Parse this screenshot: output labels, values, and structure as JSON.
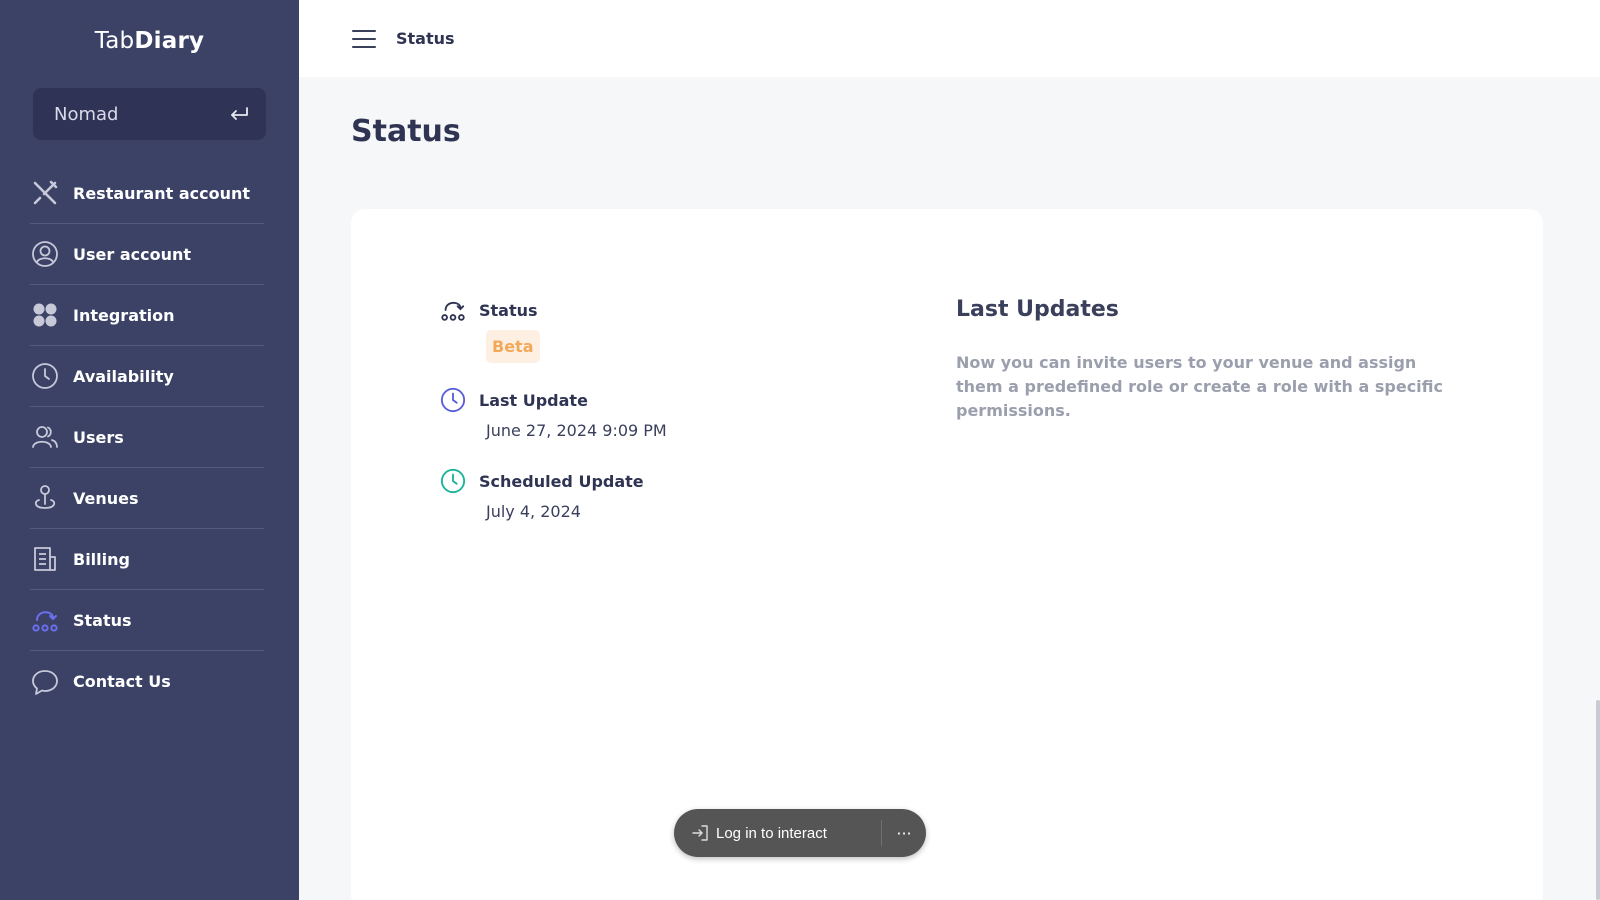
{
  "brand": {
    "prefix": "Tab",
    "suffix": "Diary"
  },
  "venue": {
    "name": "Nomad"
  },
  "sidebar": {
    "items": [
      {
        "label": "Restaurant account",
        "icon": "utensils-icon",
        "active": false
      },
      {
        "label": "User account",
        "icon": "user-circle-icon",
        "active": false
      },
      {
        "label": "Integration",
        "icon": "grid-icon",
        "active": false
      },
      {
        "label": "Availability",
        "icon": "clock-icon",
        "active": false
      },
      {
        "label": "Users",
        "icon": "users-icon",
        "active": false
      },
      {
        "label": "Venues",
        "icon": "venue-pin-icon",
        "active": false
      },
      {
        "label": "Billing",
        "icon": "billing-icon",
        "active": false
      },
      {
        "label": "Status",
        "icon": "status-route-icon",
        "active": true
      },
      {
        "label": "Contact Us",
        "icon": "chat-bubble-icon",
        "active": false
      }
    ]
  },
  "topbar": {
    "breadcrumb": "Status"
  },
  "main": {
    "page_title": "Status",
    "status": {
      "title": "Status",
      "badge": "Beta"
    },
    "last_update": {
      "title": "Last Update",
      "value": "June 27, 2024 9:09 PM"
    },
    "scheduled_update": {
      "title": "Scheduled Update",
      "value": "July 4, 2024"
    },
    "updates": {
      "title": "Last Updates",
      "text": "Now you can invite users to your venue and assign them a predefined role or create a role with a specific permissions."
    }
  },
  "pill": {
    "login_label": "Log in to interact",
    "more_label": "···"
  },
  "colors": {
    "sidebar_bg": "#3c4266",
    "accent_active": "#6b6ff0",
    "badge_bg": "#fdf0e3",
    "badge_text": "#f2a85a",
    "last_update_icon": "#5b5fd6",
    "scheduled_icon": "#19b39a"
  }
}
